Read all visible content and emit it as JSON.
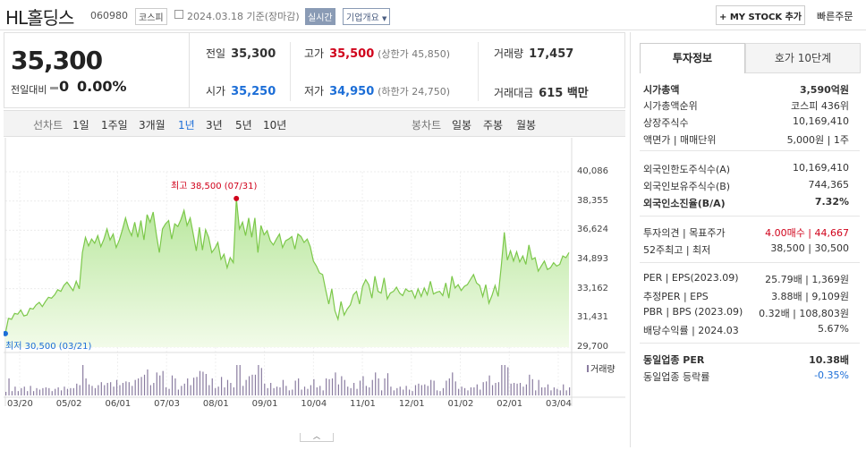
{
  "header": {
    "title": "HL홀딩스",
    "code": "060980",
    "market": "코스피",
    "date": "2024.03.18 기준(장마감)",
    "realtime": "실시간",
    "company": "기업개요",
    "mystock": "+ MY STOCK 추가",
    "quick_order": "빠른주문"
  },
  "price": {
    "current": "35,300",
    "diff_label": "전일대비",
    "diff_value": "0",
    "diff_pct": "0.00%"
  },
  "stats": {
    "prev_label": "전일",
    "prev_value": "35,300",
    "high_label": "고가",
    "high_value": "35,500",
    "high_sub": "(상한가 45,850)",
    "volume_label": "거래량",
    "volume_value": "17,457",
    "open_label": "시가",
    "open_value": "35,250",
    "low_label": "저가",
    "low_value": "34,950",
    "low_sub": "(하한가 24,750)",
    "amount_label": "거래대금",
    "amount_value": "615 백만"
  },
  "period_bar": {
    "line_label": "선차트",
    "periods": [
      "1일",
      "1주일",
      "3개월",
      "1년",
      "3년",
      "5년",
      "10년"
    ],
    "active": "1년",
    "candle_label": "봉차트",
    "candles": [
      "일봉",
      "주봉",
      "월봉"
    ]
  },
  "chart_data": {
    "type": "area",
    "y_ticks": [
      "40,086",
      "38,355",
      "36,624",
      "34,893",
      "33,162",
      "31,431",
      "29,700"
    ],
    "ylim": [
      29700,
      40086
    ],
    "x_ticks": [
      "03/20",
      "05/02",
      "06/01",
      "07/03",
      "08/01",
      "09/01",
      "10/04",
      "11/01",
      "12/01",
      "01/02",
      "02/01",
      "03/04"
    ],
    "max_annotation": "최고 38,500 (07/31)",
    "min_annotation": "최저 30,500 (03/21)",
    "max_value": 38500,
    "min_value": 30500,
    "volume_label": "거래량",
    "series": [
      {
        "values": [
          30500,
          31400,
          31350,
          31700,
          31650,
          31900,
          31550,
          31600,
          32000,
          31950,
          32200,
          32350,
          32100,
          32400,
          32650,
          32600,
          32800,
          33100,
          33000,
          33350,
          33550,
          33300,
          33050,
          33600,
          33150,
          35300,
          36200,
          35700,
          36100,
          35850,
          36300,
          35650,
          36100,
          36700,
          36050,
          36400,
          35600,
          36050,
          36650,
          37350,
          36700,
          36300,
          37100,
          36200,
          37200,
          36050,
          37550,
          37100,
          37700,
          36400,
          35300,
          36700,
          37000,
          37200,
          36100,
          37000,
          36850,
          37250,
          37800,
          36900,
          37350,
          36400,
          35400,
          36800,
          35450,
          36650,
          36200,
          35300,
          35550,
          35900,
          34900,
          35200,
          34400,
          35000,
          34700,
          38500,
          36700,
          37100,
          36300,
          37350,
          36200,
          37350,
          35300,
          36900,
          36350,
          36600,
          36000,
          35750,
          36100,
          36400,
          35600,
          36000,
          36100,
          36250,
          35500,
          36400,
          36250,
          35900,
          36100,
          35650,
          34800,
          34500,
          34100,
          34000,
          33100,
          32250,
          33150,
          31850,
          31350,
          32400,
          31600,
          31950,
          32200,
          32800,
          33000,
          32250,
          33300,
          33700,
          33400,
          32600,
          33900,
          33000,
          32900,
          33800,
          32550,
          32900,
          33000,
          33250,
          32900,
          32750,
          33150,
          33000,
          33050,
          32600,
          33150,
          32700,
          33200,
          32800,
          33600,
          32850,
          32950,
          33000,
          32750,
          33500,
          32600,
          33900,
          33200,
          33400,
          33050,
          33300,
          33400,
          33700,
          34000,
          33500,
          33350,
          32700,
          33400,
          32300,
          32750,
          33350,
          32700,
          34500,
          36500,
          34850,
          35400,
          34800,
          35350,
          34750,
          35100,
          34600,
          35750,
          34900,
          35000,
          34200,
          34500,
          34800,
          34300,
          34400,
          34700,
          34500,
          34600,
          35100,
          35000,
          35300
        ]
      }
    ]
  },
  "right": {
    "tab_active": "투자정보",
    "tab_other": "호가 10단계",
    "rows": [
      {
        "k": "시가총액",
        "v": "3,590억원",
        "bold": true
      },
      {
        "k": "시가총액순위",
        "v": "코스피 436위"
      },
      {
        "k": "상장주식수",
        "v": "10,169,410"
      },
      {
        "k": "액면가 | 매매단위",
        "v": "5,000원 | 1주"
      },
      {
        "k": "외국인한도주식수(A)",
        "v": "10,169,410"
      },
      {
        "k": "외국인보유주식수(B)",
        "v": "744,365"
      },
      {
        "k": "외국인소진율(B/A)",
        "v": "7.32%",
        "bold": true
      },
      {
        "k": "투자의견 | 목표주가",
        "v": "4.00매수 | 44,667"
      },
      {
        "k": "52주최고 | 최저",
        "v": "38,500 | 30,500"
      },
      {
        "k": "PER | EPS(2023.09)",
        "v": "25.79배 | 1,369원"
      },
      {
        "k": "추정PER | EPS",
        "v": "3.88배 | 9,109원"
      },
      {
        "k": "PBR | BPS (2023.09)",
        "v": "0.32배 | 108,803원"
      },
      {
        "k": "배당수익률 | 2024.03",
        "v": "5.67%"
      },
      {
        "k": "동일업종 PER",
        "v": "10.38배",
        "bold": true
      },
      {
        "k": "동일업종 등락률",
        "v": "-0.35%"
      }
    ]
  }
}
